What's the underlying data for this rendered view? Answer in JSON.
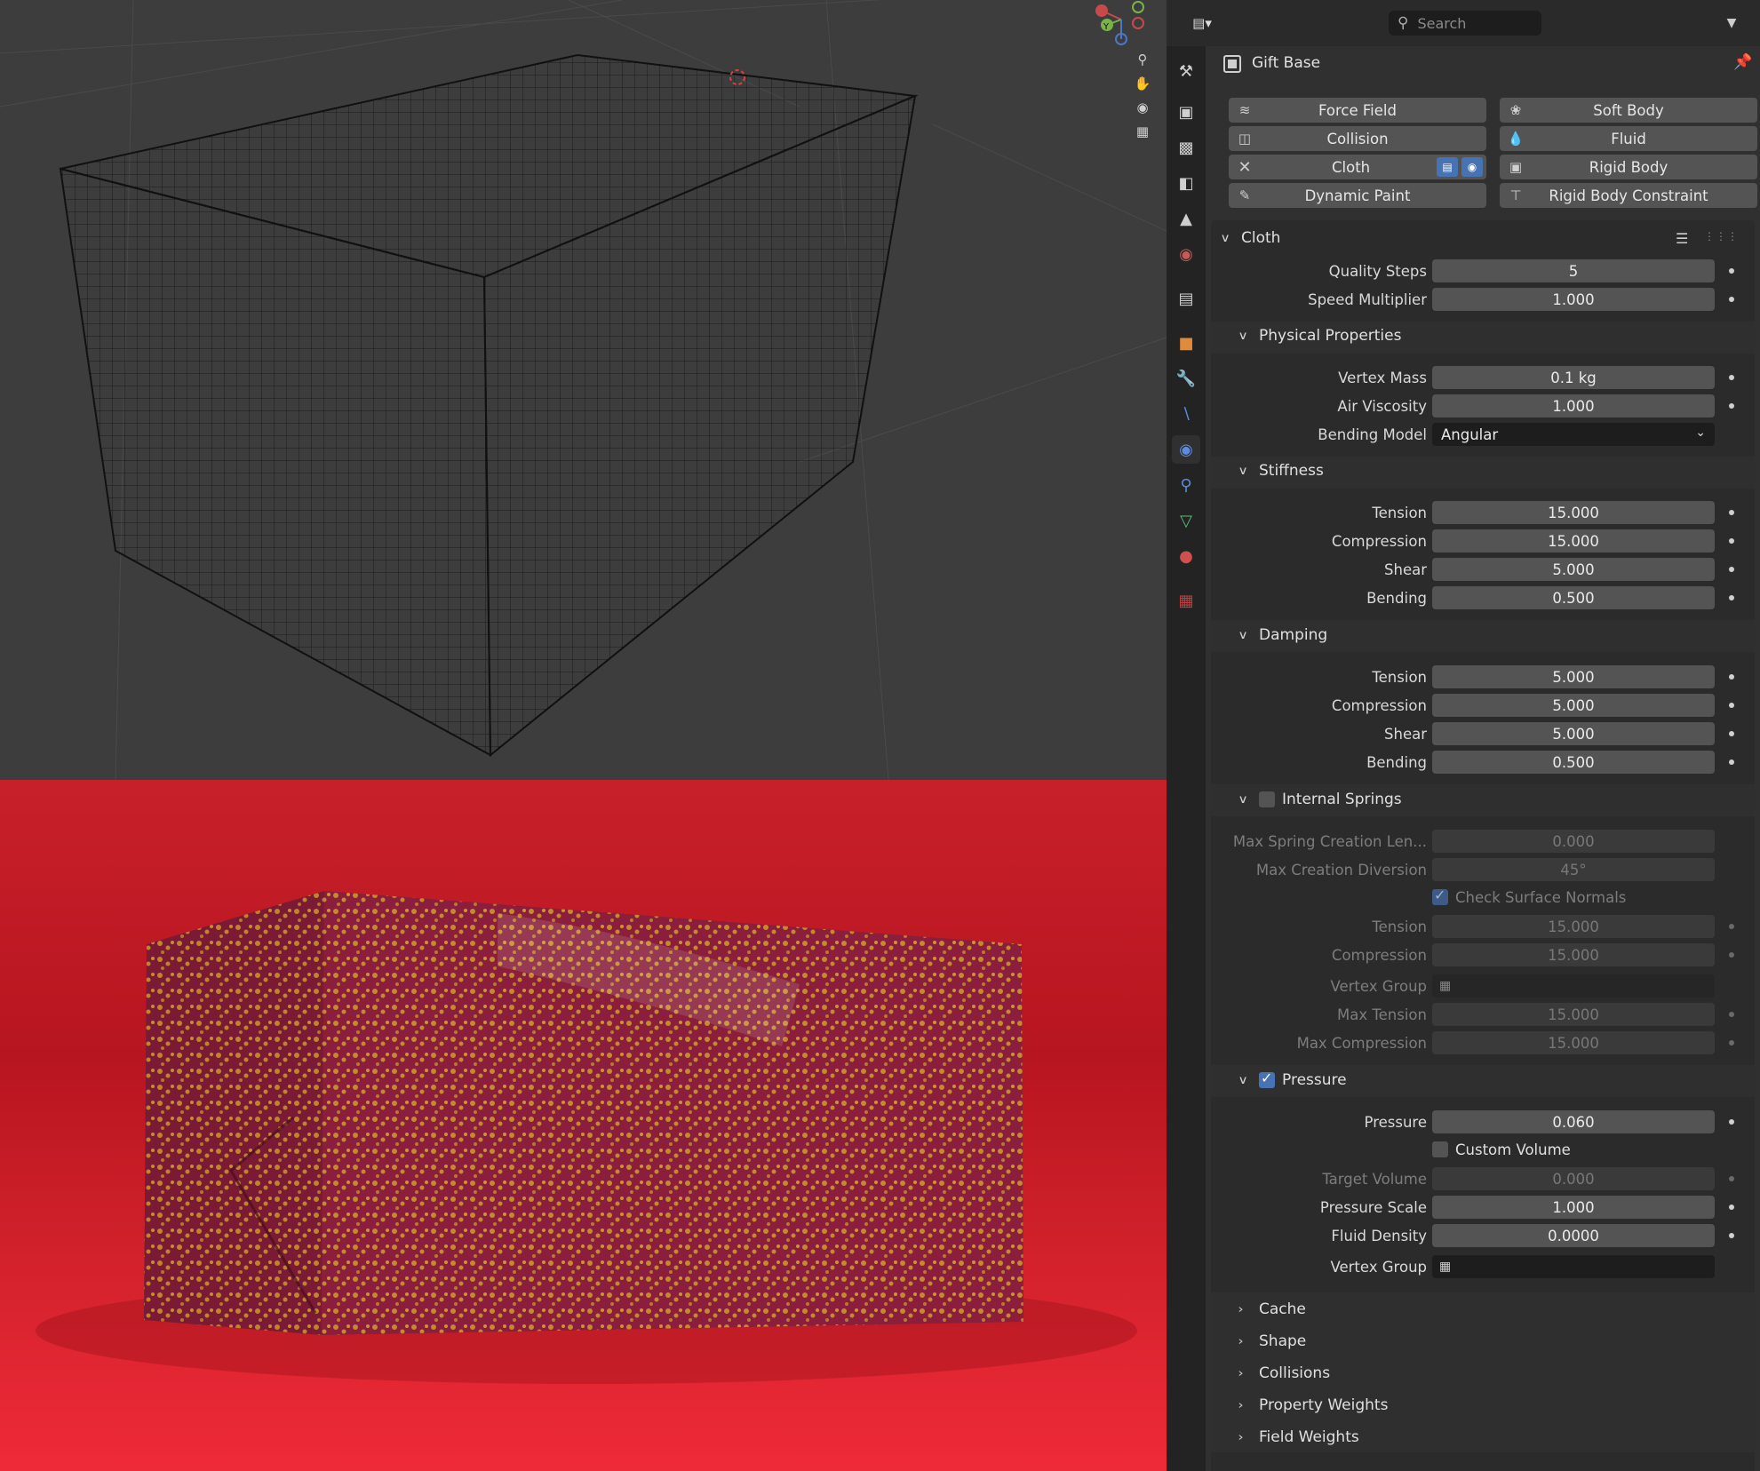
{
  "viewport": {
    "nav_icons": [
      "zoom-icon",
      "hand-pan-icon",
      "camera-view-icon",
      "perspective-grid-icon"
    ],
    "gizmo_axis_y": "Y"
  },
  "header": {
    "search_placeholder": "Search"
  },
  "object": {
    "name": "Gift Base"
  },
  "physics_buttons": {
    "force_field": "Force Field",
    "soft_body": "Soft Body",
    "collision": "Collision",
    "fluid": "Fluid",
    "cloth": "Cloth",
    "rigid_body": "Rigid Body",
    "dynamic_paint": "Dynamic Paint",
    "rigid_body_constraint": "Rigid Body Constraint"
  },
  "cloth": {
    "title": "Cloth",
    "quality_steps": {
      "label": "Quality Steps",
      "value": "5"
    },
    "speed_multiplier": {
      "label": "Speed Multiplier",
      "value": "1.000"
    },
    "physical": {
      "title": "Physical Properties",
      "vertex_mass": {
        "label": "Vertex Mass",
        "value": "0.1 kg"
      },
      "air_viscosity": {
        "label": "Air Viscosity",
        "value": "1.000"
      },
      "bending_model": {
        "label": "Bending Model",
        "value": "Angular"
      }
    },
    "stiffness": {
      "title": "Stiffness",
      "tension": {
        "label": "Tension",
        "value": "15.000"
      },
      "compression": {
        "label": "Compression",
        "value": "15.000"
      },
      "shear": {
        "label": "Shear",
        "value": "5.000"
      },
      "bending": {
        "label": "Bending",
        "value": "0.500"
      }
    },
    "damping": {
      "title": "Damping",
      "tension": {
        "label": "Tension",
        "value": "5.000"
      },
      "compression": {
        "label": "Compression",
        "value": "5.000"
      },
      "shear": {
        "label": "Shear",
        "value": "5.000"
      },
      "bending": {
        "label": "Bending",
        "value": "0.500"
      }
    },
    "internal_springs": {
      "title": "Internal Springs",
      "enabled": false,
      "max_spring_len": {
        "label": "Max Spring Creation Len...",
        "value": "0.000"
      },
      "max_diversion": {
        "label": "Max Creation Diversion",
        "value": "45°"
      },
      "check_normals": {
        "label": "Check Surface Normals",
        "checked": true
      },
      "tension": {
        "label": "Tension",
        "value": "15.000"
      },
      "compression": {
        "label": "Compression",
        "value": "15.000"
      },
      "vertex_group": {
        "label": "Vertex Group",
        "value": ""
      },
      "max_tension": {
        "label": "Max Tension",
        "value": "15.000"
      },
      "max_compression": {
        "label": "Max Compression",
        "value": "15.000"
      }
    },
    "pressure": {
      "title": "Pressure",
      "enabled": true,
      "pressure": {
        "label": "Pressure",
        "value": "0.060"
      },
      "custom_volume": {
        "label": "Custom Volume",
        "checked": false
      },
      "target_volume": {
        "label": "Target Volume",
        "value": "0.000"
      },
      "pressure_scale": {
        "label": "Pressure Scale",
        "value": "1.000"
      },
      "fluid_density": {
        "label": "Fluid Density",
        "value": "0.0000"
      },
      "vertex_group": {
        "label": "Vertex Group",
        "value": ""
      }
    },
    "collapsed": {
      "cache": "Cache",
      "shape": "Shape",
      "collisions": "Collisions",
      "property_weights": "Property Weights",
      "field_weights": "Field Weights"
    }
  },
  "colors": {
    "accent": "#4772b3",
    "panel_bg": "#303030",
    "field_bg": "#545454",
    "render_red": "#d3222c",
    "gift_purple": "#8a1e3c",
    "gift_dots": "#c8902a"
  }
}
